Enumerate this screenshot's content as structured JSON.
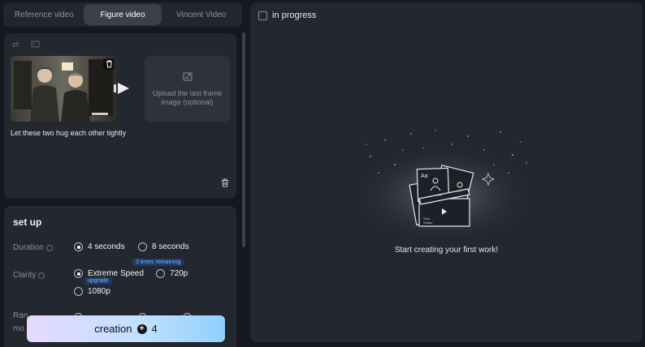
{
  "tabs": [
    {
      "label": "Reference video",
      "active": false
    },
    {
      "label": "Figure video",
      "active": true
    },
    {
      "label": "Vincent Video",
      "active": false
    }
  ],
  "upload": {
    "last_frame_text": "Upload the last frame image (optional)",
    "prompt": "Let these two hug each other tightly"
  },
  "setup": {
    "title": "set up",
    "duration": {
      "label": "Duration",
      "options": [
        "4 seconds",
        "8 seconds"
      ],
      "selected": "4 seconds"
    },
    "clarity": {
      "label": "Clarity",
      "options": [
        "Extreme Speed",
        "720p",
        "1080p"
      ],
      "selected": "Extreme Speed",
      "badge_remaining": "3 times remaining",
      "badge_upgrade": "upgrade"
    },
    "ratio_row": {
      "label_line1": "Ran",
      "label_line2": "mo"
    }
  },
  "creation_button": {
    "label": "creation",
    "cost": "4"
  },
  "right": {
    "in_progress_label": "in progress",
    "empty_state_text": "Start creating your first work!",
    "illustration_lettering": {
      "aa": "Aa",
      "brand_line1": "Vidu",
      "brand_line2": "Studio"
    }
  },
  "colors": {
    "background": "#15181f",
    "panel": "#23272f",
    "active_tab": "#3a3f4a",
    "badge_bg": "#1f3b63",
    "badge_text": "#7fb0ff"
  }
}
